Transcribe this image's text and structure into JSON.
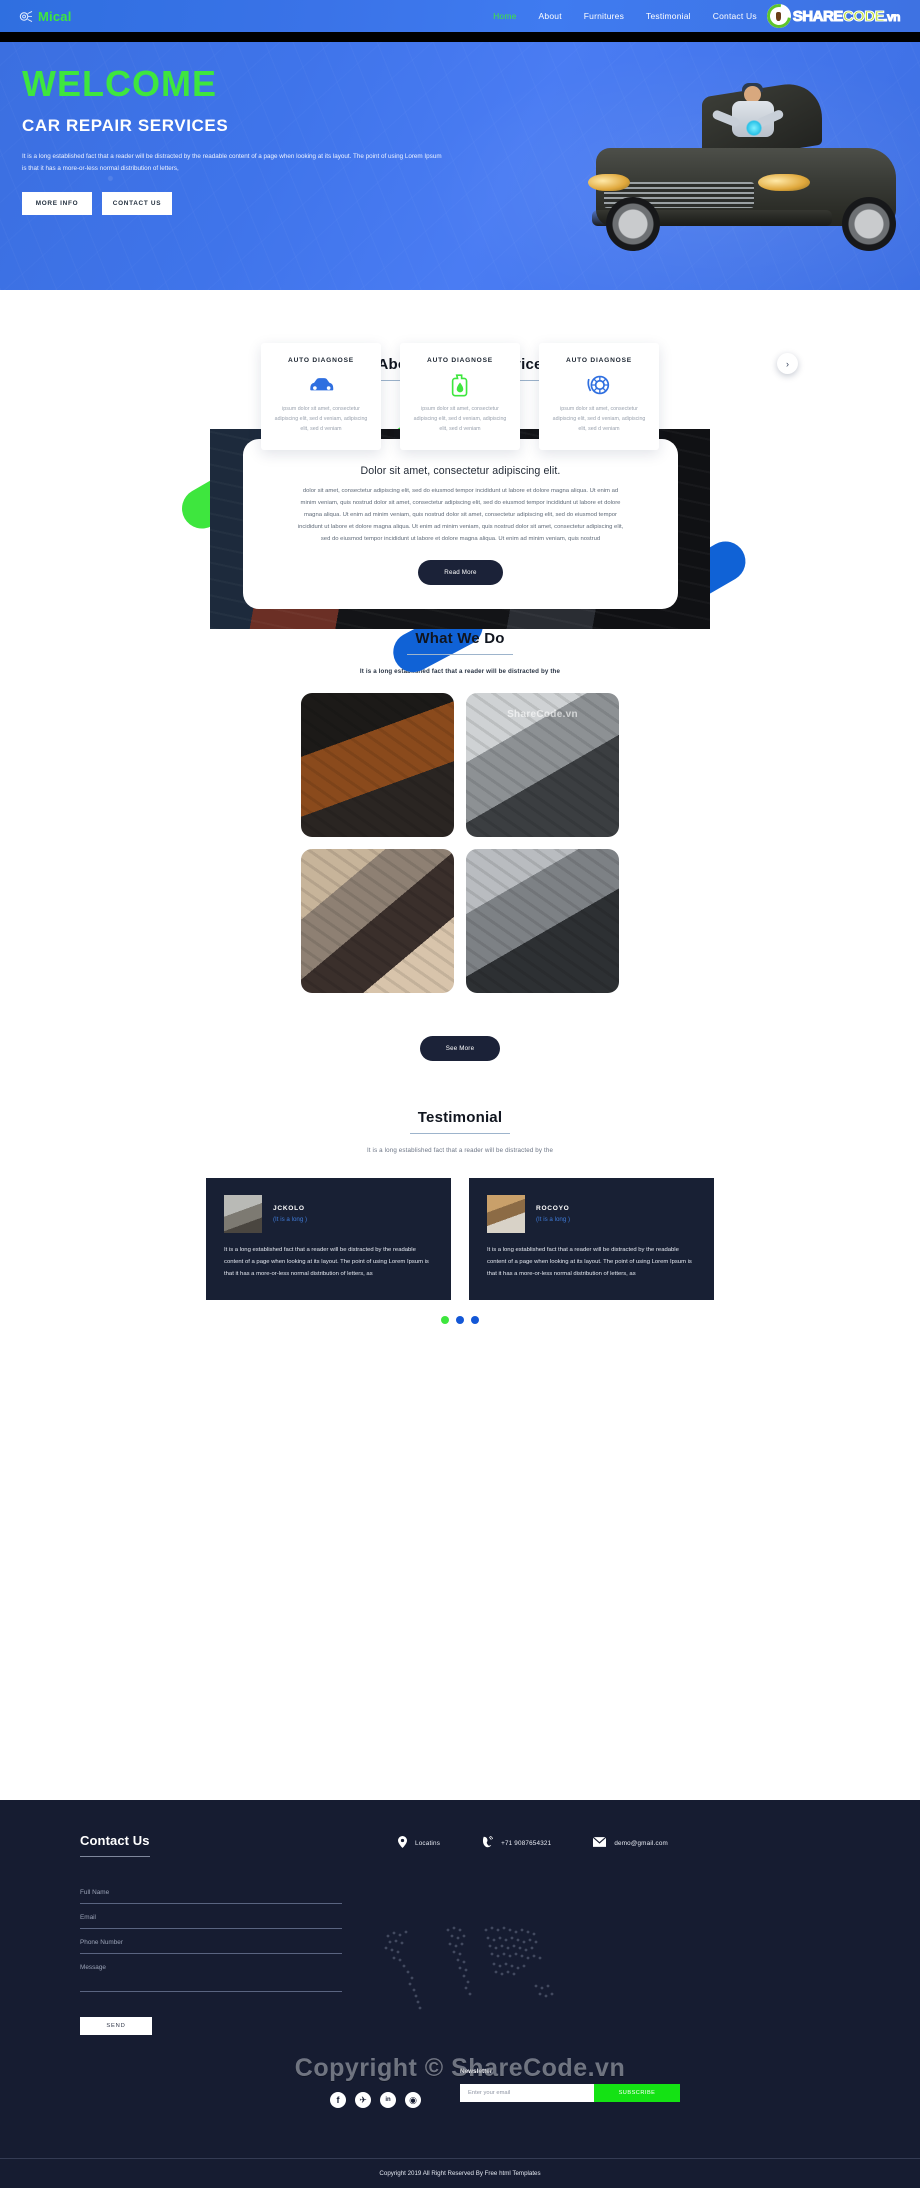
{
  "nav": {
    "brand": "Mical",
    "items": [
      {
        "label": "Home",
        "active": true
      },
      {
        "label": "About",
        "active": false
      },
      {
        "label": "Furnitures",
        "active": false
      },
      {
        "label": "Testimonial",
        "active": false
      },
      {
        "label": "Contact Us",
        "active": false
      }
    ],
    "watermark": {
      "part1": "SHARE",
      "part2": "CODE",
      "part3": ".vn"
    }
  },
  "hero": {
    "welcome": "WELCOME",
    "title": "CAR REPAIR SERVICES",
    "paragraph": "It is a long established fact that a reader will be distracted by the readable content of a page when looking at its layout. The point of using Lorem Ipsum is that it has a more-or-less normal distribution of letters,",
    "btn_more": "MORE INFO",
    "btn_contact": "CONTACT US"
  },
  "services": {
    "next_arrow": "›",
    "cards": [
      {
        "title": "AUTO DIAGNOSE",
        "icon": "car-icon",
        "text": "ipsum dolor sit amet, consectetur adipiscing elit, sed d veniam, adipiscing elit, sed d veniam"
      },
      {
        "title": "AUTO DIAGNOSE",
        "icon": "oil-can-icon",
        "text": "ipsum dolor sit amet, consectetur adipiscing elit, sed d veniam, adipiscing elit, sed d veniam"
      },
      {
        "title": "AUTO DIAGNOSE",
        "icon": "wheel-icon",
        "text": "ipsum dolor sit amet, consectetur adipiscing elit, sed d veniam, adipiscing elit, sed d veniam"
      }
    ]
  },
  "about": {
    "heading": "About Our Car Service",
    "card_title": "Dolor sit amet, consectetur adipiscing elit.",
    "card_text": "dolor sit amet, consectetur adipiscing elit, sed do eiusmod tempor incididunt ut labore et dolore magna aliqua. Ut enim ad minim veniam, quis nostrud dolor sit amet, consectetur adipiscing elit, sed do eiusmod tempor incididunt ut labore et dolore magna aliqua. Ut enim ad minim veniam, quis nostrud dolor sit amet, consectetur adipiscing elit, sed do eiusmod tempor incididunt ut labore et dolore magna aliqua. Ut enim ad minim veniam, quis nostrud dolor sit amet, consectetur adipiscing elit, sed do eiusmod tempor incididunt ut labore et dolore magna aliqua. Ut enim ad minim veniam, quis nostrud",
    "button": "Read More"
  },
  "what_we_do": {
    "heading": "What We Do",
    "subheading": "It is a long established fact that a reader will be distracted by the",
    "tile_watermark": "ShareCode.vn",
    "button": "See More"
  },
  "testimonial": {
    "heading": "Testimonial",
    "subheading": "It is a long established fact that a reader will be distracted by the",
    "cards": [
      {
        "name": "JCKOLO",
        "role": "(It is a long )",
        "text": "It is a long established fact that a reader will be distracted by the readable content of a page when looking at its layout. The point of using Lorem Ipsum is that it has a more-or-less normal distribution of letters, as"
      },
      {
        "name": "ROCOYO",
        "role": "(It is a long )",
        "text": "It is a long established fact that a reader will be distracted by the readable content of a page when looking at its layout. The point of using Lorem Ipsum is that it has a more-or-less normal distribution of letters, as"
      }
    ],
    "dots": [
      "green",
      "blue",
      "blue"
    ]
  },
  "footer": {
    "title": "Contact Us",
    "contacts": [
      {
        "icon": "location-pin-icon",
        "label": "Locatins"
      },
      {
        "icon": "phone-icon",
        "label": "+71 9087654321"
      },
      {
        "icon": "envelope-icon",
        "label": "demo@gmail.com"
      }
    ],
    "form": {
      "full_name_placeholder": "Full Name",
      "email_placeholder": "Email",
      "phone_placeholder": "Phone Number",
      "message_placeholder": "Message",
      "send_label": "SEND"
    },
    "socials": [
      {
        "name": "facebook-icon",
        "glyph": "f"
      },
      {
        "name": "twitter-icon",
        "glyph": "✈"
      },
      {
        "name": "linkedin-icon",
        "glyph": "in"
      },
      {
        "name": "instagram-icon",
        "glyph": "◉"
      }
    ],
    "newsletter": {
      "title": "Newsletter",
      "placeholder": "Enter your email",
      "button": "SUBSCRIBE"
    },
    "copyright": "Copyright 2019 All Right Reserved By Free html Templates"
  },
  "watermark_big": "Copyright © ShareCode.vn"
}
